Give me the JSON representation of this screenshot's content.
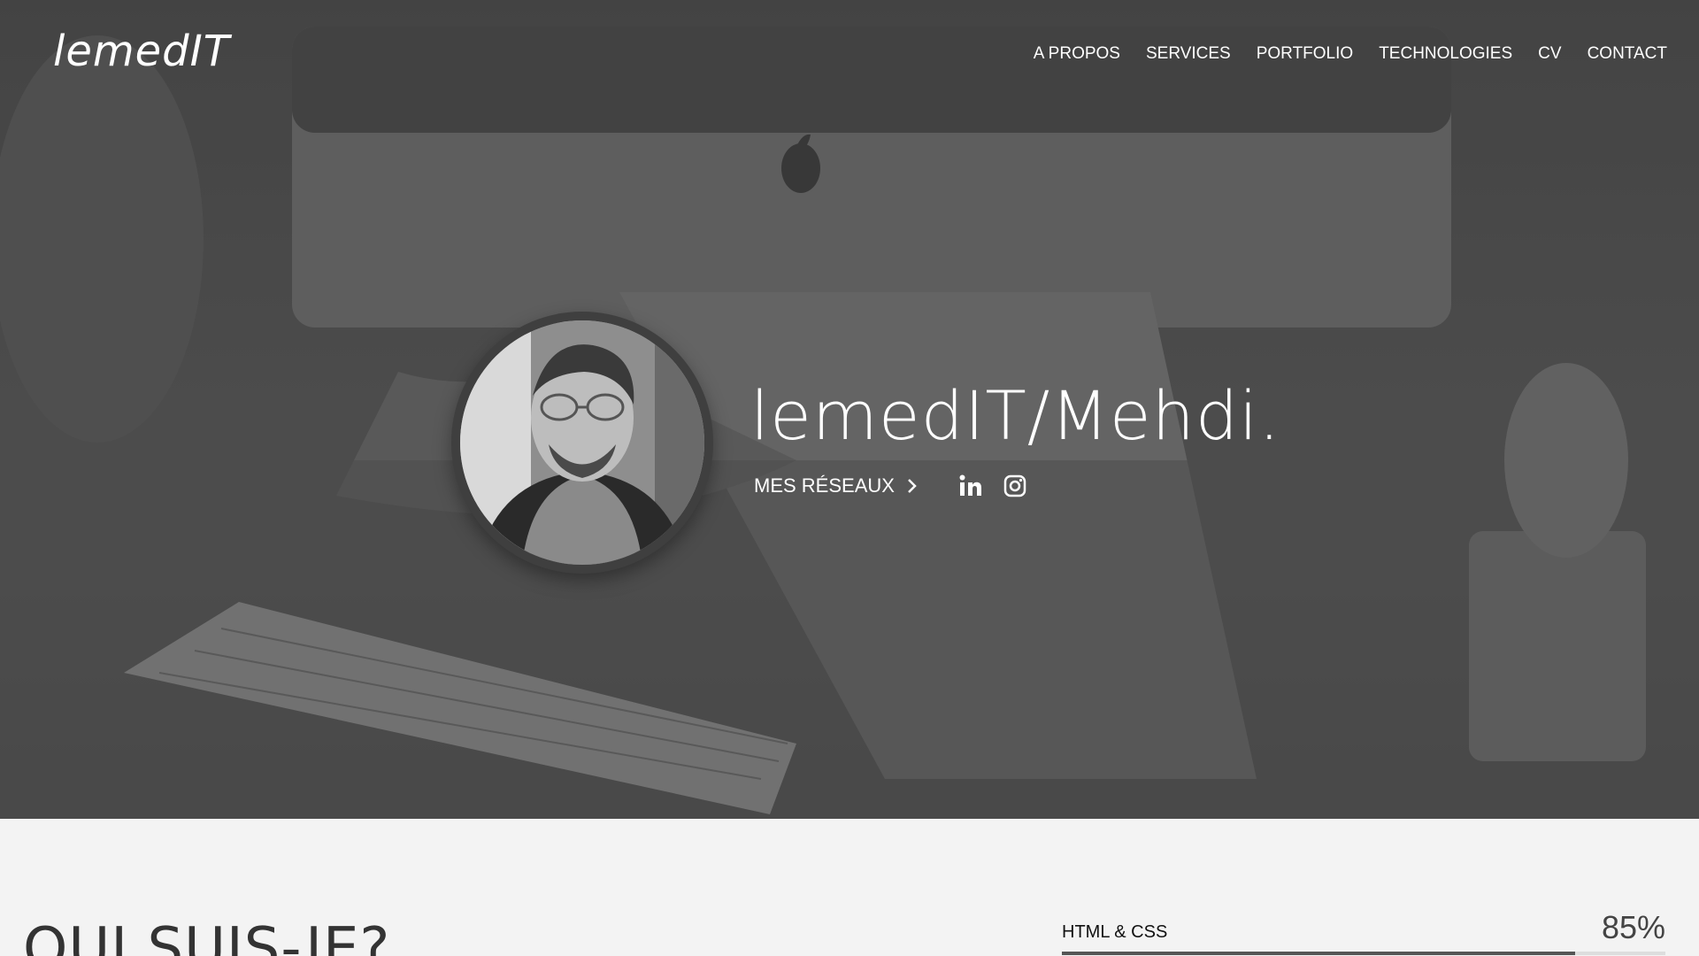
{
  "header": {
    "logo": "lemedIT",
    "nav": [
      "A PROPOS",
      "SERVICES",
      "PORTFOLIO",
      "TECHNOLOGIES",
      "CV",
      "CONTACT"
    ]
  },
  "hero": {
    "title": "lemedIT/Mehdi.",
    "networks_label": "MES RÉSEAUX",
    "icons": [
      "chevron-right-icon",
      "linkedin-icon",
      "instagram-icon"
    ]
  },
  "about": {
    "title": "QUI SUIS-JE?",
    "skills": [
      {
        "name": "HTML & CSS",
        "value_label": "85%",
        "value": 0.85
      }
    ]
  },
  "colors": {
    "hero_overlay": "#4f4f4f",
    "section_background": "#f3f3f3",
    "text_light": "#ffffff",
    "text_dark": "#333333"
  }
}
